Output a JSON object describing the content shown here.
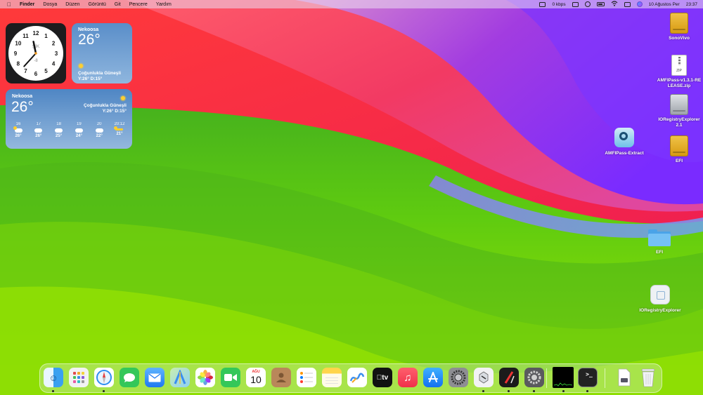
{
  "menubar": {
    "apple_icon": "apple-logo-icon",
    "app_name": "Finder",
    "menus": [
      "Dosya",
      "Düzen",
      "Görüntü",
      "Git",
      "Pencere",
      "Yardım"
    ],
    "network_speed": "0 kbps",
    "status_icons": [
      "keyboard-icon",
      "display-icon",
      "user-icon",
      "battery-icon",
      "wifi-icon",
      "control-center-icon",
      "siri-icon"
    ],
    "date": "10 Ağustos Per",
    "time": "23:37"
  },
  "clock_widget": {
    "label": "ŞİK",
    "offset": "-8",
    "numerals": [
      "12",
      "1",
      "2",
      "3",
      "4",
      "5",
      "6",
      "7",
      "8",
      "9",
      "10",
      "11"
    ],
    "time_shown": "23:37"
  },
  "weather_small": {
    "city": "Nekoosa",
    "temperature": "26°",
    "condition": "Çoğunlukla Güneşli",
    "high_low": "Y:26° D:15°"
  },
  "weather_large": {
    "city": "Nekoosa",
    "temperature": "26°",
    "condition": "Çoğunlukla Güneşli",
    "high_low": "Y:26° D:15°",
    "forecast": [
      {
        "hour": "16",
        "temp": "26°",
        "icon": "partly-sunny-icon"
      },
      {
        "hour": "17",
        "temp": "26°",
        "icon": "cloud-icon"
      },
      {
        "hour": "18",
        "temp": "25°",
        "icon": "cloud-icon"
      },
      {
        "hour": "19",
        "temp": "24°",
        "icon": "cloud-icon"
      },
      {
        "hour": "20",
        "temp": "22°",
        "icon": "cloud-icon"
      },
      {
        "hour": "20:12",
        "temp": "21°",
        "icon": "sunset-icon"
      }
    ]
  },
  "desktop_items": [
    {
      "label": "SonoVivo",
      "icon": "external-drive-icon"
    },
    {
      "label": "AMFIPass-v1.3.1-RELEASE.zip",
      "icon": "zip-file-icon",
      "badge": "ZIP"
    },
    {
      "label": "IORegistryExplorer 2.1",
      "icon": "disk-image-icon"
    },
    {
      "label": "EFI",
      "icon": "external-drive-icon"
    },
    {
      "label": "AMFIPass-Extract",
      "icon": "amfipass-app-icon"
    },
    {
      "label": "EFI",
      "icon": "folder-icon"
    },
    {
      "label": "IORegistryExplorer",
      "icon": "ioregistry-app-icon"
    }
  ],
  "dock": {
    "apps": [
      {
        "name": "Finder",
        "icon": "finder-icon",
        "running": true
      },
      {
        "name": "Launchpad",
        "icon": "launchpad-icon",
        "running": false
      },
      {
        "name": "Safari",
        "icon": "safari-icon",
        "running": true
      },
      {
        "name": "Messages",
        "icon": "messages-icon",
        "running": false
      },
      {
        "name": "Mail",
        "icon": "mail-icon",
        "running": false
      },
      {
        "name": "Maps",
        "icon": "maps-icon",
        "running": false
      },
      {
        "name": "Photos",
        "icon": "photos-icon",
        "running": false
      },
      {
        "name": "FaceTime",
        "icon": "facetime-icon",
        "running": false
      },
      {
        "name": "Calendar",
        "icon": "calendar-icon",
        "running": false,
        "month": "AĞU",
        "day": "10"
      },
      {
        "name": "Contacts",
        "icon": "contacts-icon",
        "running": false
      },
      {
        "name": "Reminders",
        "icon": "reminders-icon",
        "running": false
      },
      {
        "name": "Notes",
        "icon": "notes-icon",
        "running": false
      },
      {
        "name": "Freeform",
        "icon": "freeform-icon",
        "running": false
      },
      {
        "name": "Apple TV",
        "icon": "apple-tv-icon",
        "running": false,
        "label": "tv"
      },
      {
        "name": "Music",
        "icon": "music-icon",
        "running": false
      },
      {
        "name": "App Store",
        "icon": "app-store-icon",
        "running": false
      },
      {
        "name": "System Settings",
        "icon": "system-settings-icon",
        "running": false
      },
      {
        "name": "Disk Utility",
        "icon": "disk-utility-icon",
        "running": true
      },
      {
        "name": "Script Editor",
        "icon": "script-editor-icon",
        "running": true
      },
      {
        "name": "Settings",
        "icon": "gear-icon",
        "running": true
      }
    ],
    "recent": [
      {
        "name": "Activity Monitor",
        "icon": "activity-monitor-icon",
        "running": true
      },
      {
        "name": "Terminal",
        "icon": "terminal-icon",
        "running": true
      }
    ],
    "trailing": [
      {
        "name": "Document",
        "icon": "document-icon"
      },
      {
        "name": "Trash",
        "icon": "trash-icon"
      }
    ]
  }
}
